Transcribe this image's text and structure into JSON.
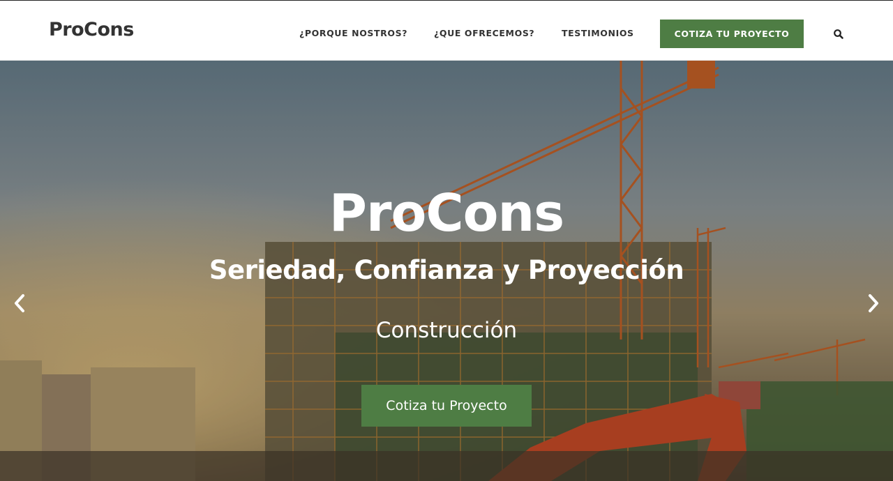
{
  "header": {
    "logo": "ProCons",
    "nav": [
      {
        "label": "¿PORQUE NOSTROS?"
      },
      {
        "label": "¿QUE OFRECEMOS?"
      },
      {
        "label": "TESTIMONIOS"
      }
    ],
    "cta_label": "COTIZA TU PROYECTO",
    "search_icon": "search-icon"
  },
  "hero": {
    "title": "ProCons",
    "subtitle": "Seriedad, Confianza y Proyección",
    "tagline": "Construcción",
    "button_label": "Cotiza tu Proyecto",
    "prev_icon": "chevron-left-icon",
    "next_icon": "chevron-right-icon"
  },
  "colors": {
    "accent": "#4e7d44",
    "text_dark": "#333333",
    "hero_text": "#ffffff"
  }
}
